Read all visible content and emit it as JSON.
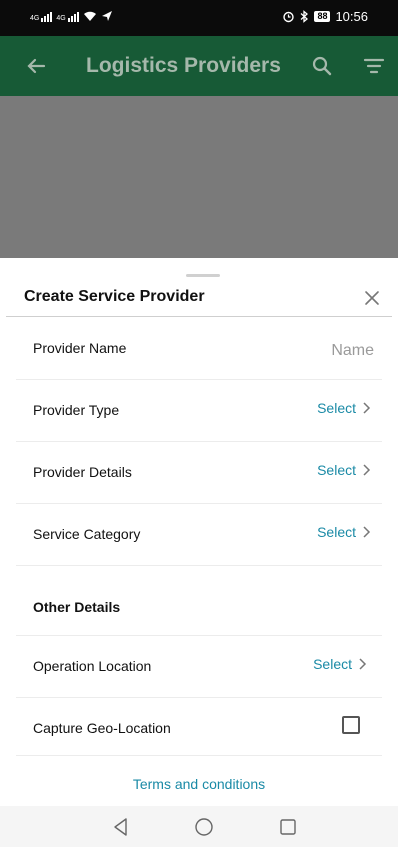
{
  "status_bar": {
    "signal_label_1": "4G",
    "signal_label_2": "4G",
    "battery": "88",
    "time": "10:56"
  },
  "app_bar": {
    "title": "Logistics Providers",
    "color": "#175a36",
    "icons": [
      "arrow-back-icon",
      "search-icon",
      "filter-icon"
    ]
  },
  "sheet": {
    "title": "Create Service Provider",
    "close_icon": "close-icon",
    "rows": [
      {
        "label": "Provider Name",
        "placeholder": "Name"
      },
      {
        "label": "Provider Type",
        "action": "Select"
      },
      {
        "label": "Provider Details",
        "action": "Select"
      },
      {
        "label": "Service Category",
        "action": "Select"
      }
    ],
    "section_heading": "Other Details",
    "other_rows": [
      {
        "label": "Operation Location",
        "action": "Select"
      },
      {
        "label": "Capture Geo-Location",
        "checked": false
      }
    ],
    "terms_link": "Terms and conditions",
    "link_color": "#1a8aa6"
  },
  "nav_bar": {
    "icons": [
      "nav-back-icon",
      "nav-home-icon",
      "nav-recents-icon"
    ]
  }
}
